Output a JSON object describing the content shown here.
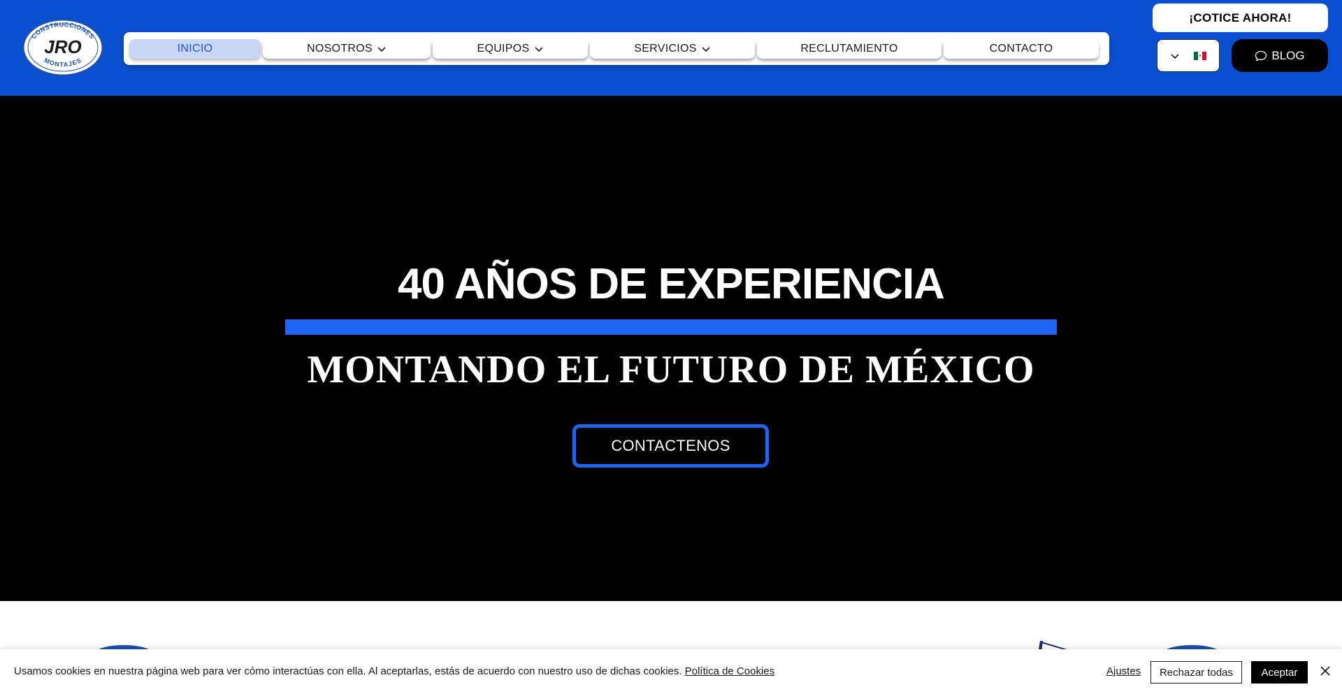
{
  "header": {
    "logo": {
      "top_text": "CONSTRUCCIONES",
      "center_text": "JRO",
      "bottom_text": "MONTAJES"
    },
    "nav": [
      {
        "label": "INICIO",
        "active": true,
        "dropdown": false
      },
      {
        "label": "NOSOTROS",
        "active": false,
        "dropdown": true
      },
      {
        "label": "EQUIPOS",
        "active": false,
        "dropdown": true
      },
      {
        "label": "SERVICIOS",
        "active": false,
        "dropdown": true
      },
      {
        "label": "RECLUTAMIENTO",
        "active": false,
        "dropdown": false
      },
      {
        "label": "CONTACTO",
        "active": false,
        "dropdown": false
      }
    ],
    "cta_label": "¡COTICE AHORA!",
    "language_flag": "mexico-flag-icon",
    "blog_label": "BLOG"
  },
  "hero": {
    "title": "40 AÑOS DE EXPERIENCIA",
    "subtitle": "MONTANDO EL FUTURO DE MÉXICO",
    "button_label": "CONTACTENOS"
  },
  "cookie_banner": {
    "text": "Usamos cookies en nuestra página web para ver cómo interactúas con ella. Al aceptarlas, estás de acuerdo con nuestro uso de dichas cookies.",
    "policy_link": "Política de Cookies",
    "settings_label": "Ajustes",
    "reject_label": "Rechazar todas",
    "accept_label": "Aceptar"
  },
  "colors": {
    "header_blue": "#0b4fd1",
    "accent_blue": "#1f64f2",
    "hero_bg": "#000000"
  }
}
